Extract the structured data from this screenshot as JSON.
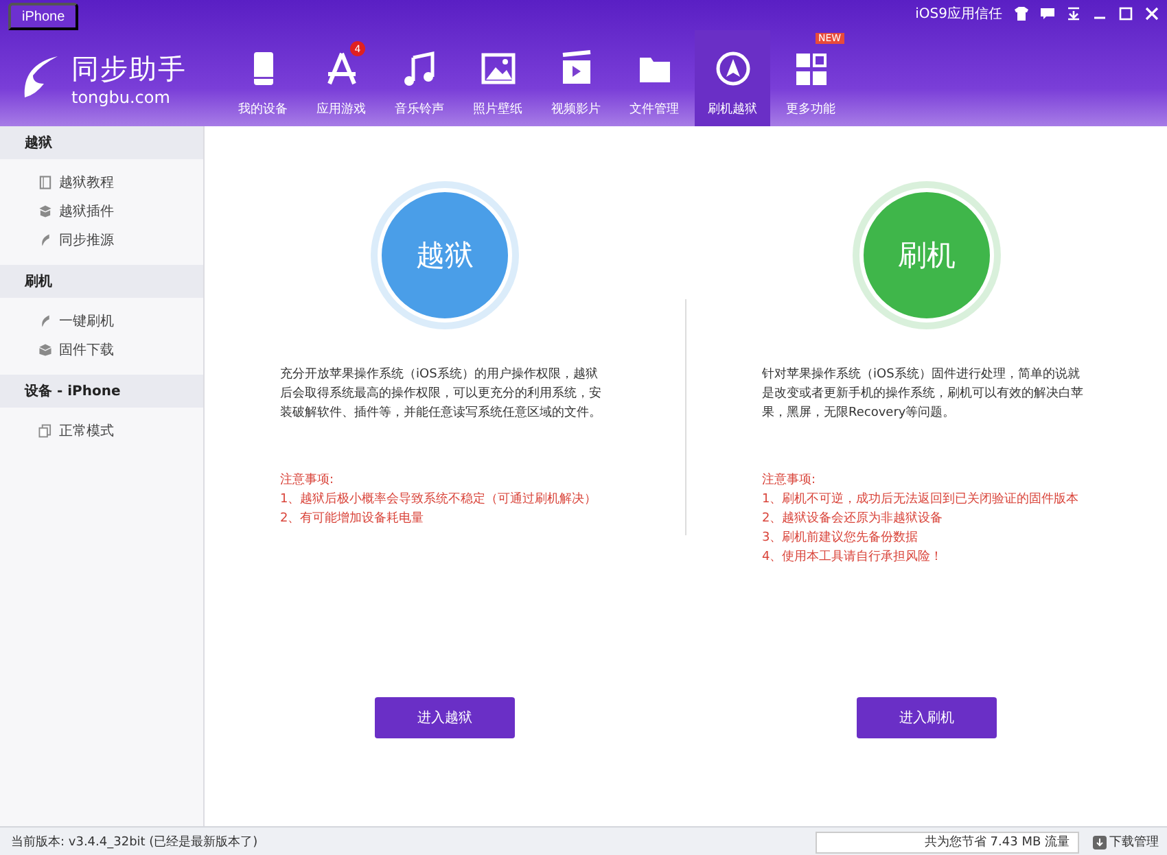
{
  "device_tab": {
    "label": "iPhone"
  },
  "logo": {
    "title": "同步助手",
    "subtitle": "tongbu.com"
  },
  "top_link": "iOS9应用信任",
  "nav": [
    {
      "label": "我的设备",
      "selected": false
    },
    {
      "label": "应用游戏",
      "selected": false,
      "badge": {
        "kind": "count",
        "text": "4"
      }
    },
    {
      "label": "音乐铃声",
      "selected": false
    },
    {
      "label": "照片壁纸",
      "selected": false
    },
    {
      "label": "视频影片",
      "selected": false
    },
    {
      "label": "文件管理",
      "selected": false
    },
    {
      "label": "刷机越狱",
      "selected": true
    },
    {
      "label": "更多功能",
      "selected": false,
      "badge": {
        "kind": "new",
        "text": "NEW"
      }
    }
  ],
  "sidebar": [
    {
      "title": "越狱",
      "items": [
        "越狱教程",
        "越狱插件",
        "同步推源"
      ]
    },
    {
      "title": "刷机",
      "items": [
        "一键刷机",
        "固件下载"
      ]
    },
    {
      "title": "设备 - iPhone",
      "items": [
        "正常模式"
      ]
    }
  ],
  "panels": [
    {
      "title": "越狱",
      "color": "#4a9ee8",
      "description": "充分开放苹果操作系统（iOS系统）的用户操作权限，越狱后会取得系统最高的操作权限，可以更充分的利用系统，安装破解软件、插件等，并能任意读写系统任意区域的文件。",
      "notes_title": "注意事项:",
      "notes": [
        "1、越狱后极小概率会导致系统不稳定（可通过刷机解决）",
        "2、有可能增加设备耗电量"
      ],
      "button": "进入越狱"
    },
    {
      "title": "刷机",
      "color": "#3fb64a",
      "description": "针对苹果操作系统（iOS系统）固件进行处理，简单的说就是改变或者更新手机的操作系统，刷机可以有效的解决白苹果，黑屏，无限Recovery等问题。",
      "notes_title": "注意事项:",
      "notes": [
        "1、刷机不可逆，成功后无法返回到已关闭验证的固件版本",
        "2、越狱设备会还原为非越狱设备",
        "3、刷机前建议您先备份数据",
        "4、使用本工具请自行承担风险！"
      ],
      "button": "进入刷机"
    }
  ],
  "status_bar": {
    "version": "当前版本: v3.4.4_32bit  (已经是最新版本了)",
    "saved": "共为您节省 7.43 MB 流量",
    "downloads": "下载管理"
  }
}
